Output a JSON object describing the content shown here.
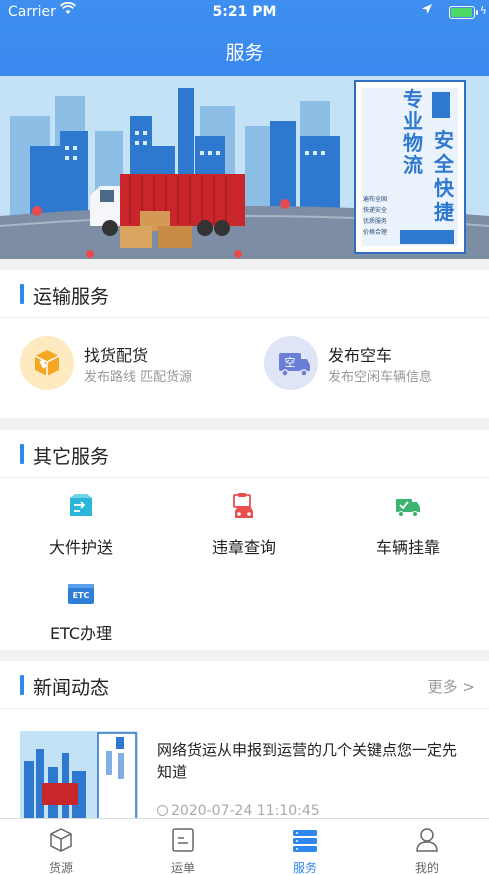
{
  "status": {
    "carrier": "Carrier",
    "time": "5:21 PM",
    "battery_level": 1.0
  },
  "header": {
    "title": "服务"
  },
  "banner": {
    "slogan_1": "专业物流",
    "slogan_2": "安全快捷",
    "features": [
      "遍布全国",
      "快递安全",
      "优质服务",
      "价格合理"
    ]
  },
  "transport": {
    "title": "运输服务",
    "items": [
      {
        "name": "找货配货",
        "desc": "发布路线  匹配货源",
        "icon": "box-icon"
      },
      {
        "name": "发布空车",
        "desc": "发布空闲车辆信息",
        "icon": "empty-truck-icon",
        "badge": "空"
      }
    ]
  },
  "other": {
    "title": "其它服务",
    "items": [
      {
        "label": "大件护送",
        "icon": "escort-truck-icon"
      },
      {
        "label": "违章查询",
        "icon": "violation-car-icon"
      },
      {
        "label": "车辆挂靠",
        "icon": "truck-affiliation-icon"
      },
      {
        "label": "ETC办理",
        "icon": "etc-card-icon",
        "badge": "ETC"
      }
    ]
  },
  "news": {
    "title": "新闻动态",
    "more": "更多 >",
    "items": [
      {
        "title": "网络货运从申报到运营的几个关键点您一定先知道",
        "time": "2020-07-24 11:10:45"
      }
    ]
  },
  "tabs": [
    {
      "label": "货源",
      "icon": "cube-icon"
    },
    {
      "label": "运单",
      "icon": "waybill-icon"
    },
    {
      "label": "服务",
      "icon": "service-icon",
      "active": true
    },
    {
      "label": "我的",
      "icon": "user-icon"
    }
  ],
  "colors": {
    "primary": "#3a89ef",
    "accent_bar": "#2f88ee",
    "orange": "#f5a623",
    "red": "#e94f4f",
    "green": "#3cb371"
  }
}
